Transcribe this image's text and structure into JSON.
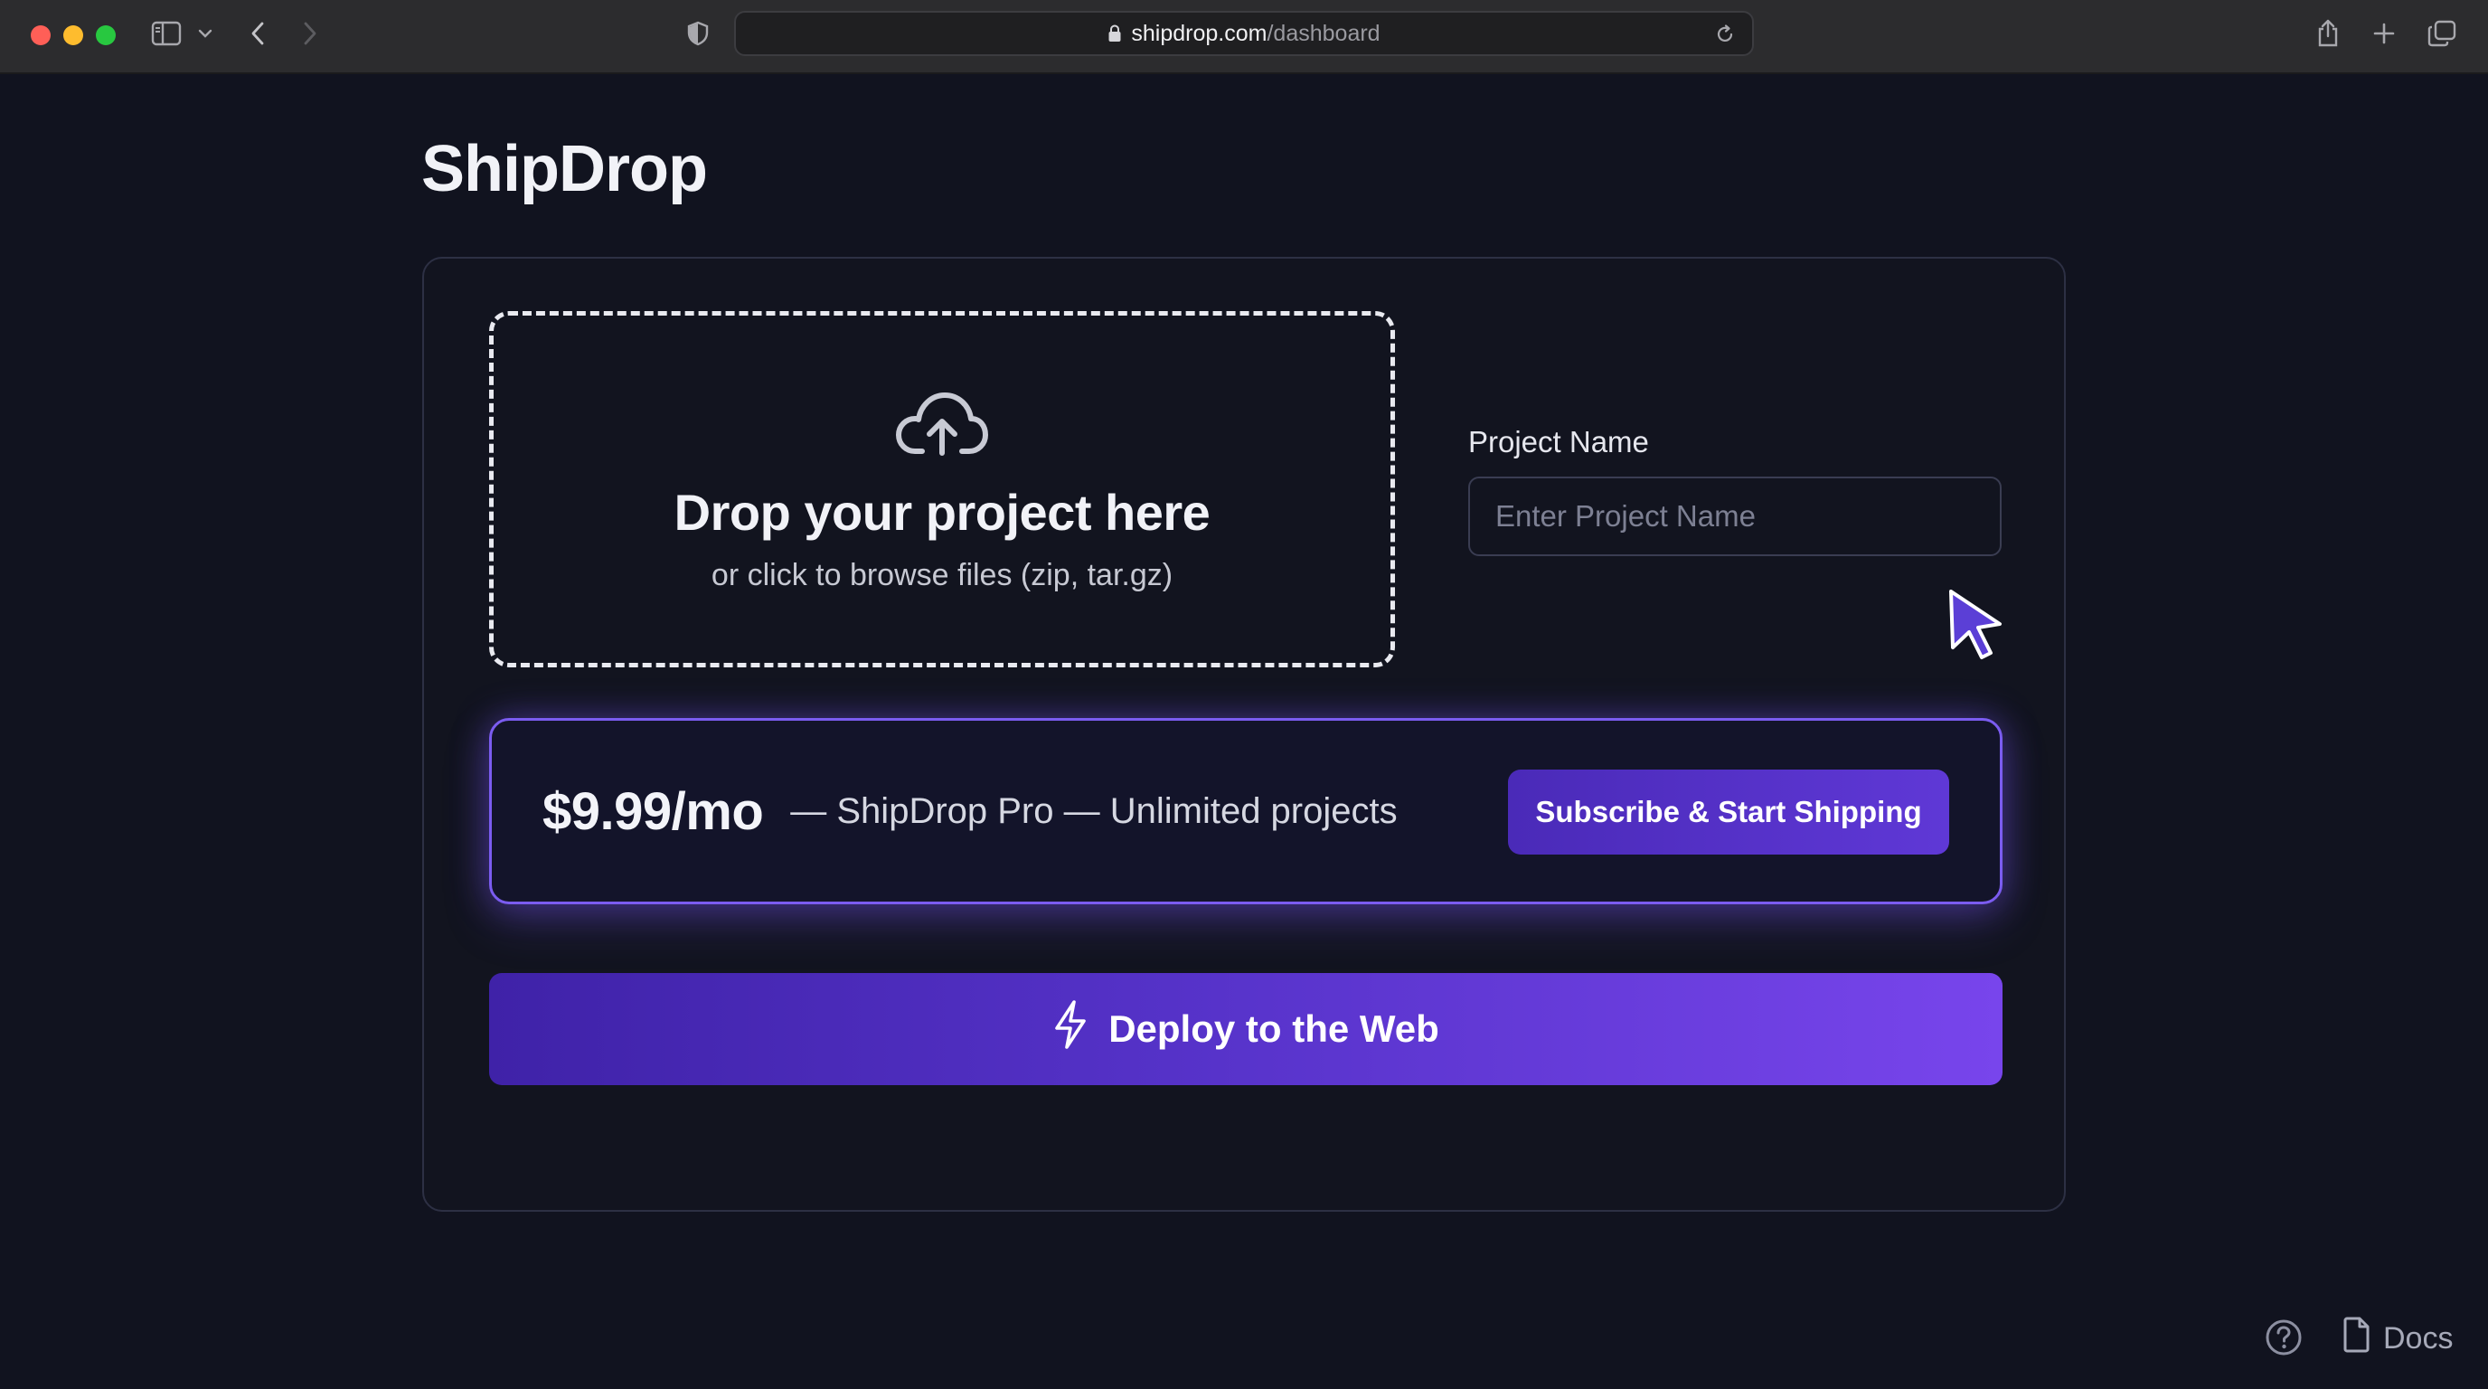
{
  "browser": {
    "url_host": "shipdrop.com",
    "url_path": "/dashboard",
    "icons": [
      "sidebar-icon",
      "chevron-down-icon",
      "back-icon",
      "forward-icon",
      "shield-icon",
      "lock-icon",
      "reload-icon",
      "share-icon",
      "plus-icon",
      "tabs-icon"
    ]
  },
  "app": {
    "title": "ShipDrop"
  },
  "dropzone": {
    "title": "Drop your project here",
    "subtitle": "or click to browse files (zip, tar.gz)",
    "icon": "cloud-upload-icon"
  },
  "project_name": {
    "label": "Project Name",
    "placeholder": "Enter Project Name",
    "value": ""
  },
  "pricing": {
    "price": "$9.99/mo",
    "description": "— ShipDrop Pro — Unlimited projects",
    "subscribe_label": "Subscribe & Start Shipping"
  },
  "deploy": {
    "label": "Deploy to the Web",
    "icon": "lightning-icon"
  },
  "footer": {
    "docs_label": "Docs",
    "icons": [
      "help-icon",
      "document-icon"
    ]
  },
  "colors": {
    "background": "#11131f",
    "accent": "#7b5cf0",
    "button_gradient_start": "#3f22a8",
    "button_gradient_end": "#7845ec"
  }
}
